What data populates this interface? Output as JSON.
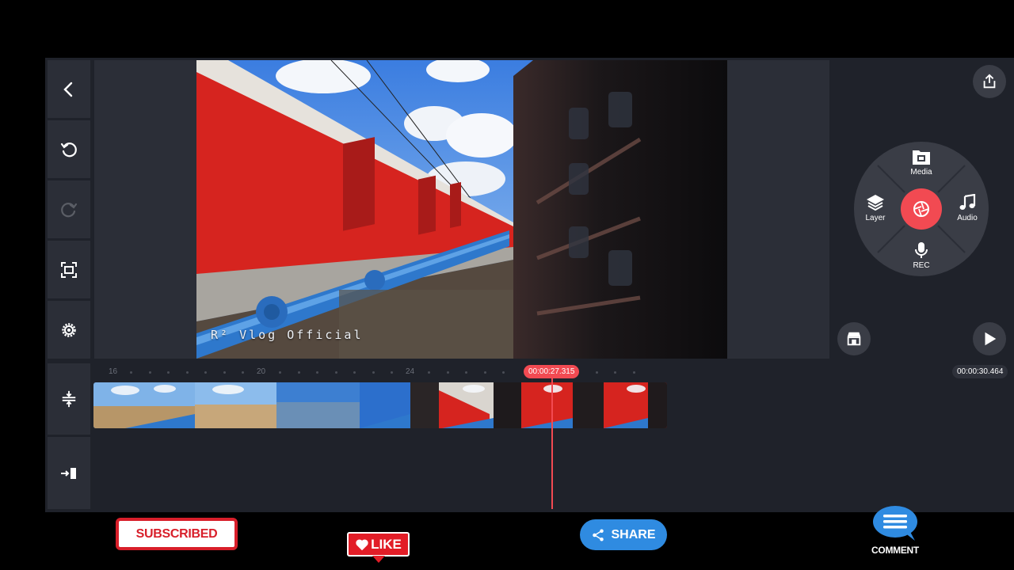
{
  "preview": {
    "watermark": "R² Vlog Official"
  },
  "wheel": {
    "media_label": "Media",
    "layer_label": "Layer",
    "audio_label": "Audio",
    "rec_label": "REC"
  },
  "timeline": {
    "ruler_labels": [
      "16",
      "20",
      "24"
    ],
    "current_time": "00:00:27.315",
    "total_time": "00:00:30.464"
  },
  "overlay": {
    "subscribed_label": "SUBSCRIBED",
    "like_label": "LIKE",
    "share_label": "SHARE",
    "comment_label": "COMMENT"
  },
  "colors": {
    "accent": "#f24a52",
    "panel": "#2b2e37",
    "background": "#1f222a",
    "share_blue": "#2f8be1",
    "subscribe_red": "#d81f2a"
  }
}
